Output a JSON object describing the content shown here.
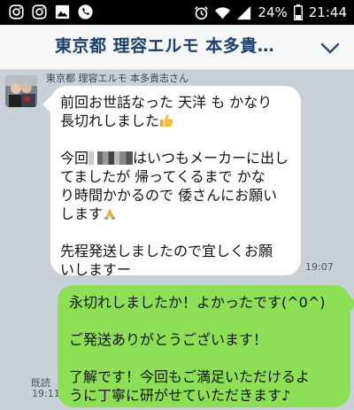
{
  "status_bar": {
    "battery": "24%",
    "time": "21:44",
    "icons": [
      "instagram-icon",
      "instagram-icon",
      "image-icon",
      "phone-icon",
      "alarm-icon",
      "wifi-icon",
      "signal-icon",
      "battery-icon"
    ]
  },
  "header": {
    "title": "東京都 理容エルモ 本多貴…",
    "chevron": "chevron-down-icon"
  },
  "received": {
    "sender": "東京都 理容エルモ 本多貴志さん",
    "p1_line1": "前回お世話なった 天洋 も かなり",
    "p1_line2": "長切れしました",
    "p2_line1a": "今回",
    "p2_line1b": "はいつもメーカーに出し",
    "p2_line2": "てましたが 帰ってくるまで かな",
    "p2_line3": "り時間かかるので 倭さんにお願い",
    "p2_line4": "します",
    "p3_line1": "先程発送しましたので宜しくお願",
    "p3_line2": "いしますー",
    "time": "19:07"
  },
  "sent": {
    "line1": "永切れしましたか！よかったです(^0^)",
    "line2": "ご発送ありがとうございます！",
    "line3": "了解です！今回もご満足いただけるよ",
    "line4": "うに丁寧に研がせていただきます♪",
    "read_label": "既読",
    "time": "19:11"
  },
  "colors": {
    "chat_background": "#c8d0d9",
    "sent_bubble": "#8de055",
    "received_bubble": "#ffffff",
    "header_title": "#1d3f6b"
  }
}
